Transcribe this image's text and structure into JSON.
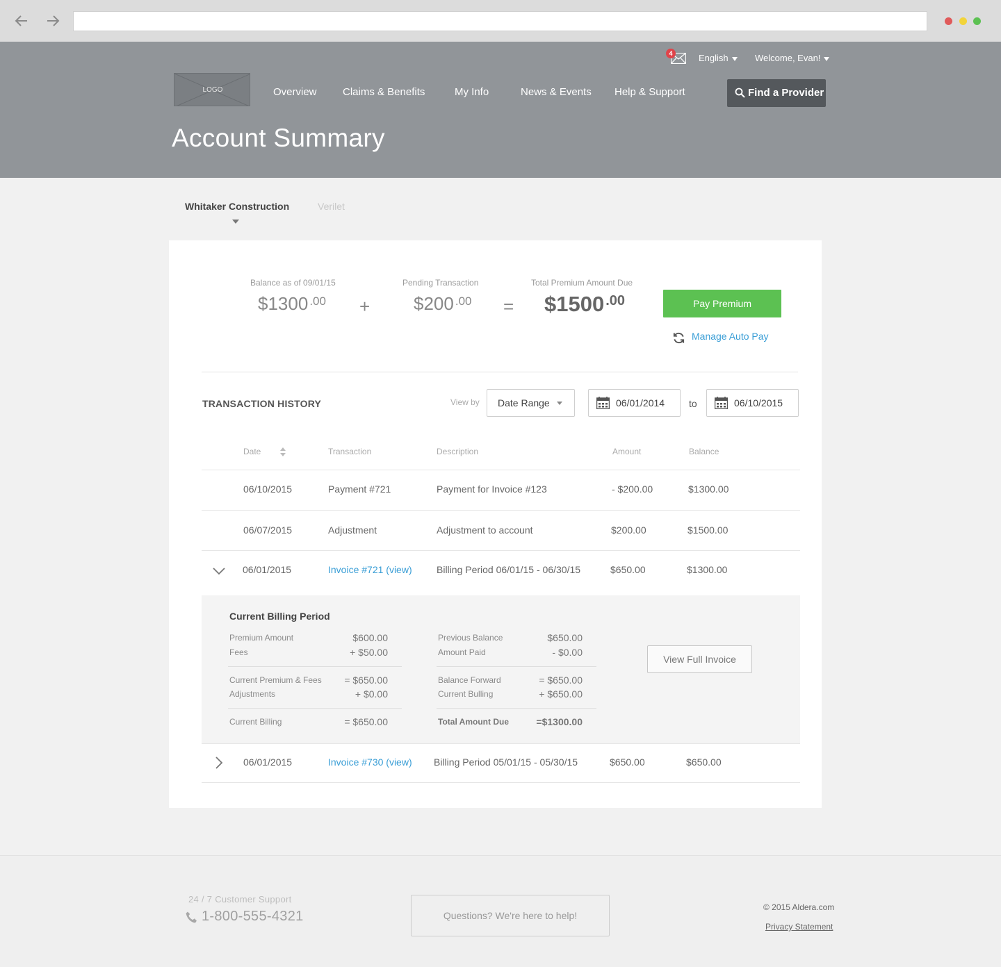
{
  "browser": {
    "back_icon": "arrow-left-icon",
    "forward_icon": "arrow-right-icon",
    "url": ""
  },
  "colors": {
    "header_bg": "#919599",
    "link": "#3a9ed6",
    "pay_button": "#5cc152",
    "badge": "#e0444a"
  },
  "header": {
    "logo": "LOGO",
    "notification_count": "4",
    "language": "English",
    "welcome": "Welcome, Evan!",
    "nav": [
      "Overview",
      "Claims & Benefits",
      "My Info",
      "News & Events",
      "Help & Support"
    ],
    "find_provider": "Find a Provider",
    "page_title": "Account Summary"
  },
  "accounts": {
    "active": "Whitaker Construction",
    "inactive": "Verilet"
  },
  "summary": {
    "balance_label": "Balance as of 09/01/15",
    "balance_main": "$1300",
    "balance_cents": ".00",
    "plus": "+",
    "pending_label": "Pending Transaction",
    "pending_main": "$200",
    "pending_cents": ".00",
    "equals": "=",
    "total_label": "Total Premium Amount Due",
    "total_main": "$1500",
    "total_cents": ".00",
    "pay_button": "Pay Premium",
    "manage_autopay": "Manage Auto Pay"
  },
  "history": {
    "title": "TRANSACTION HISTORY",
    "view_by_label": "View by",
    "view_by_value": "Date Range",
    "from_date": "06/01/2014",
    "to_label": "to",
    "to_date": "06/10/2015",
    "columns": [
      "Date",
      "Transaction",
      "Description",
      "Amount",
      "Balance"
    ],
    "rows": [
      {
        "date": "06/10/2015",
        "transaction": "Payment #721",
        "description": "Payment for Invoice #123",
        "amount": "- $200.00",
        "balance": "$1300.00"
      },
      {
        "date": "06/07/2015",
        "transaction": "Adjustment",
        "description": "Adjustment to account",
        "amount": "$200.00",
        "balance": "$1500.00"
      },
      {
        "date": "06/01/2015",
        "transaction": "Invoice #721 (view)",
        "description": "Billing Period 06/01/15 - 06/30/15",
        "amount": "$650.00",
        "balance": "$1300.00"
      },
      {
        "date": "06/01/2015",
        "transaction": "Invoice #730 (view)",
        "description": "Billing Period 05/01/15 - 05/30/15",
        "amount": "$650.00",
        "balance": "$650.00"
      }
    ]
  },
  "detail": {
    "title": "Current Billing Period",
    "premium_amount_label": "Premium Amount",
    "premium_amount": "$600.00",
    "fees_label": "Fees",
    "fees": "+ $50.00",
    "current_premium_fees_label": "Current Premium & Fees",
    "current_premium_fees": "= $650.00",
    "adjustments_label": "Adjustments",
    "adjustments": "+ $0.00",
    "current_billing_label": "Current Billing",
    "current_billing": "= $650.00",
    "previous_balance_label": "Previous Balance",
    "previous_balance": "$650.00",
    "amount_paid_label": "Amount Paid",
    "amount_paid": "- $0.00",
    "balance_forward_label": "Balance Forward",
    "balance_forward": "= $650.00",
    "current_bulling_label": "Current Bulling",
    "current_bulling": "+ $650.00",
    "total_due_label": "Total Amount Due",
    "total_due": "=$1300.00",
    "view_full_invoice": "View Full Invoice"
  },
  "footer": {
    "support_label": "24 / 7 Customer Support",
    "phone": "1-800-555-4321",
    "help": "Questions? We're here to help!",
    "copyright": "© 2015 Aldera.com",
    "privacy": "Privacy Statement"
  }
}
